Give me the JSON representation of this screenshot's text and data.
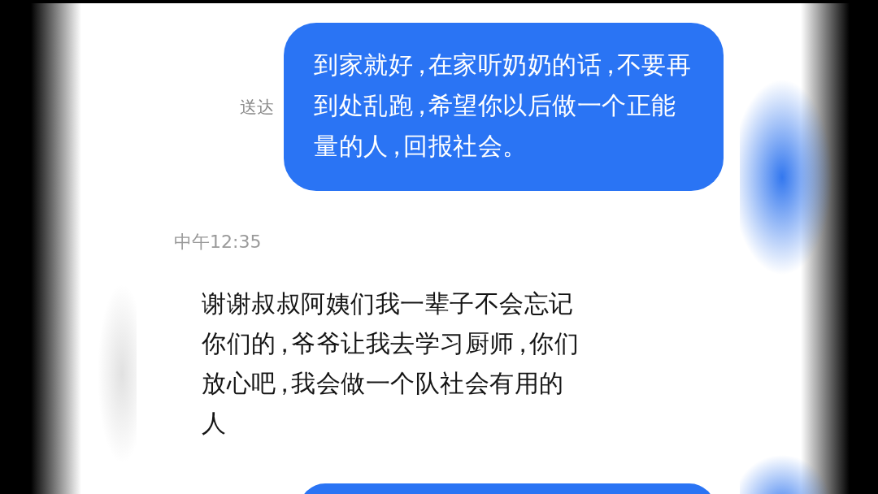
{
  "messages": [
    {
      "kind": "sent",
      "text": "到家就好，在家听奶奶的话，不要再到处乱跑，希望你以后做一个正能量的人，回报社会。",
      "status": "送达"
    },
    {
      "kind": "timestamp",
      "text": "中午12:35"
    },
    {
      "kind": "received",
      "text": "谢谢叔叔阿姨们我一辈子不会忘记你们的，爷爷让我去学习厨师，你们放心吧，我会做一个队社会有用的人"
    },
    {
      "kind": "sent"
    }
  ]
}
